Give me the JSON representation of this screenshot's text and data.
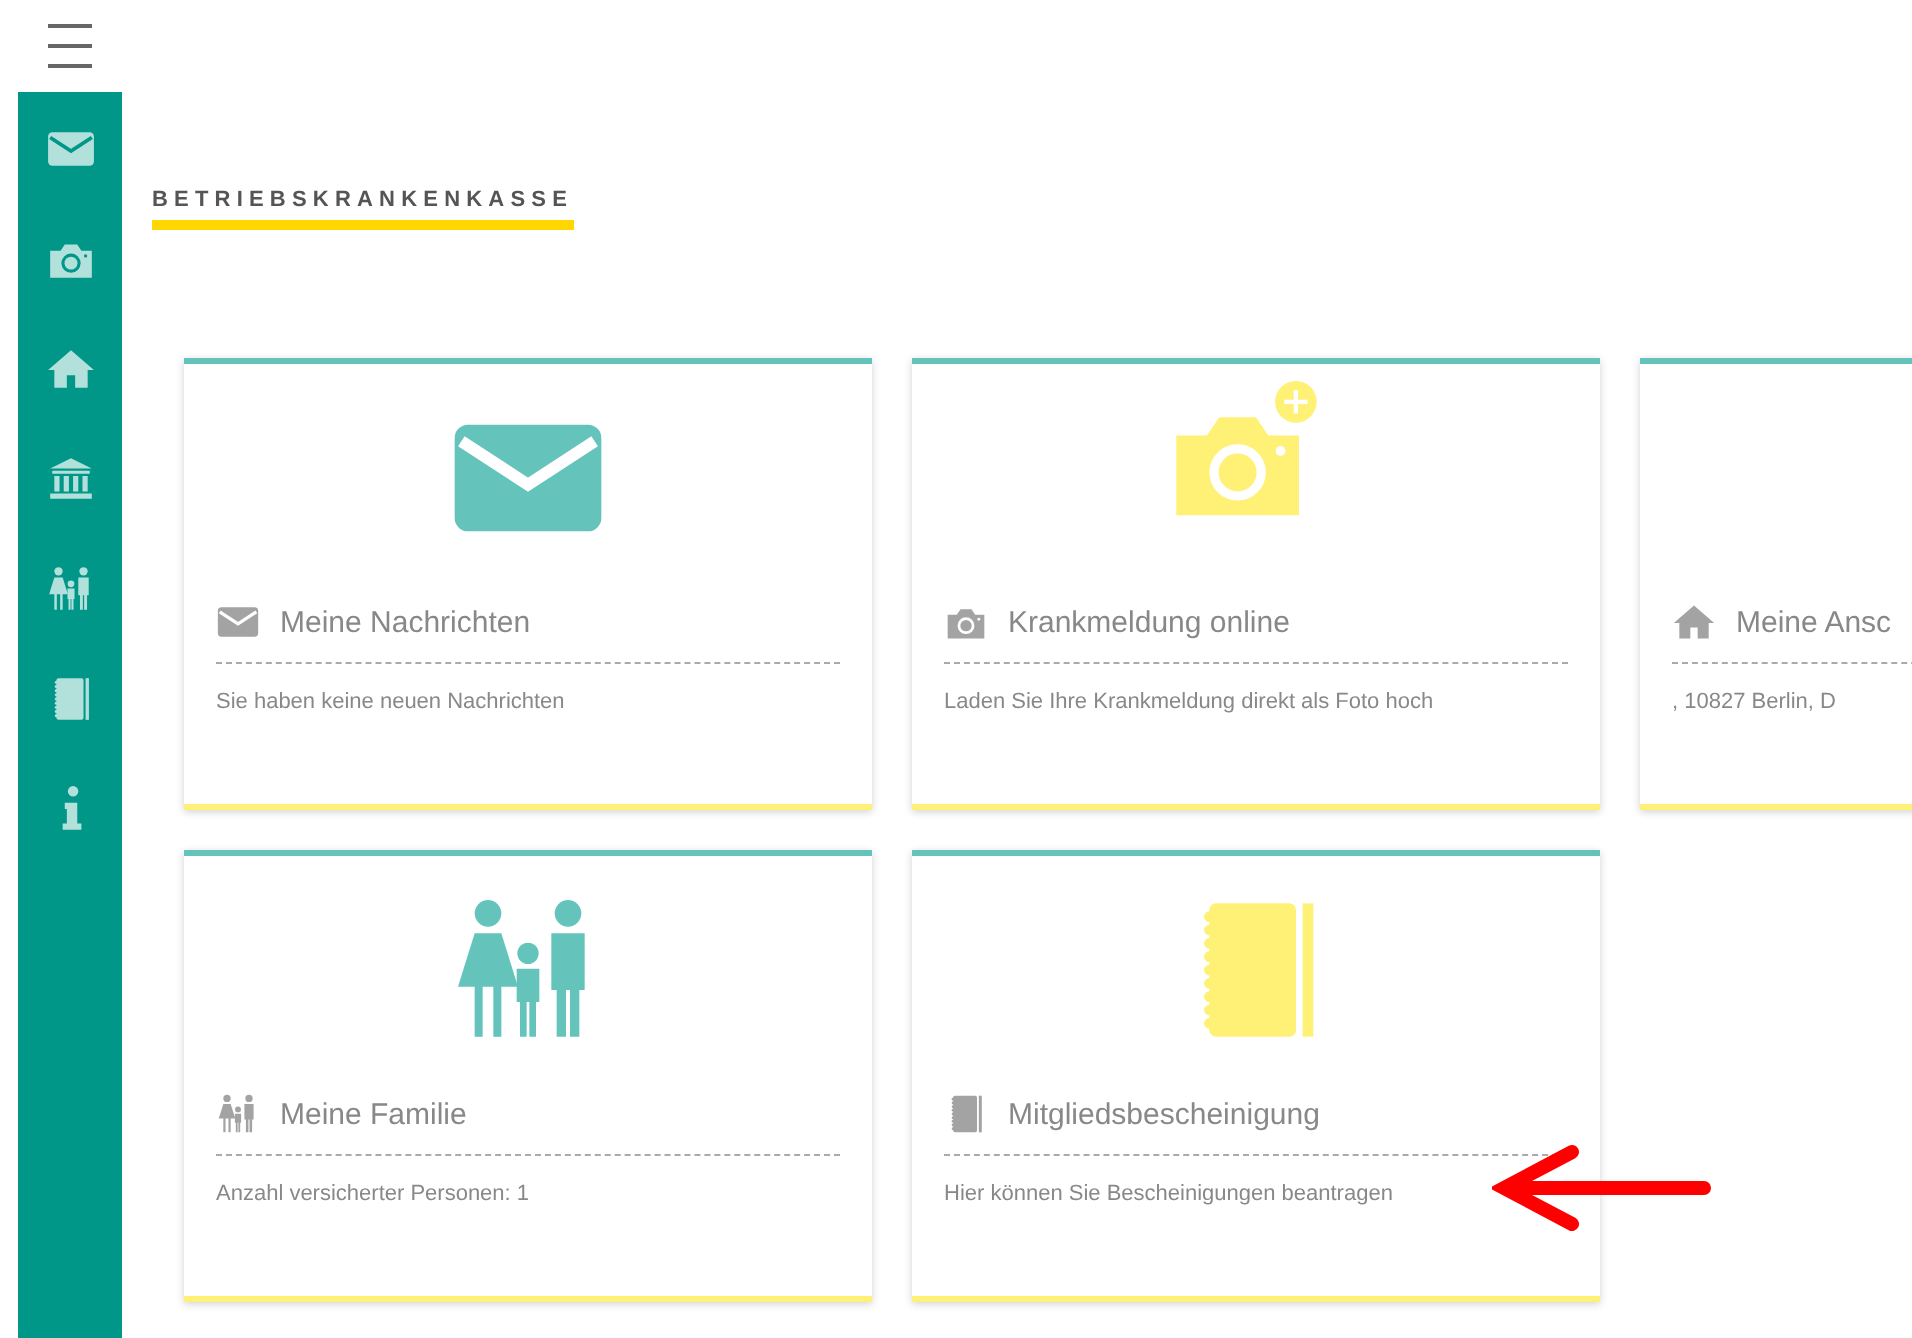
{
  "sidebar": {
    "items": [
      {
        "kind": "mail"
      },
      {
        "kind": "camera"
      },
      {
        "kind": "home"
      },
      {
        "kind": "bank"
      },
      {
        "kind": "family"
      },
      {
        "kind": "notebook"
      },
      {
        "kind": "info"
      }
    ]
  },
  "heading": "BETRIEBSKRANKENKASSE",
  "cards": [
    {
      "kind": "mail",
      "color": "#64c4bc",
      "title": "Meine Nachrichten",
      "text": "Sie haben keine neuen Nachrichten"
    },
    {
      "kind": "camera-plus",
      "color": "#fff176",
      "title": "Krankmeldung online",
      "text": "Laden Sie Ihre Krankmeldung direkt als Foto hoch"
    },
    {
      "kind": "home",
      "title": "Meine Ansc",
      "text": ", 10827 Berlin, D"
    },
    {
      "kind": "family",
      "color": "#64c4bc",
      "title": "Meine Familie",
      "text": "Anzahl versicherter Personen: 1"
    },
    {
      "kind": "notebook",
      "color": "#fff176",
      "title": "Mitgliedsbescheinigung",
      "text": "Hier können Sie Bescheinigungen beantragen"
    }
  ],
  "annotation": {
    "kind": "arrow"
  }
}
